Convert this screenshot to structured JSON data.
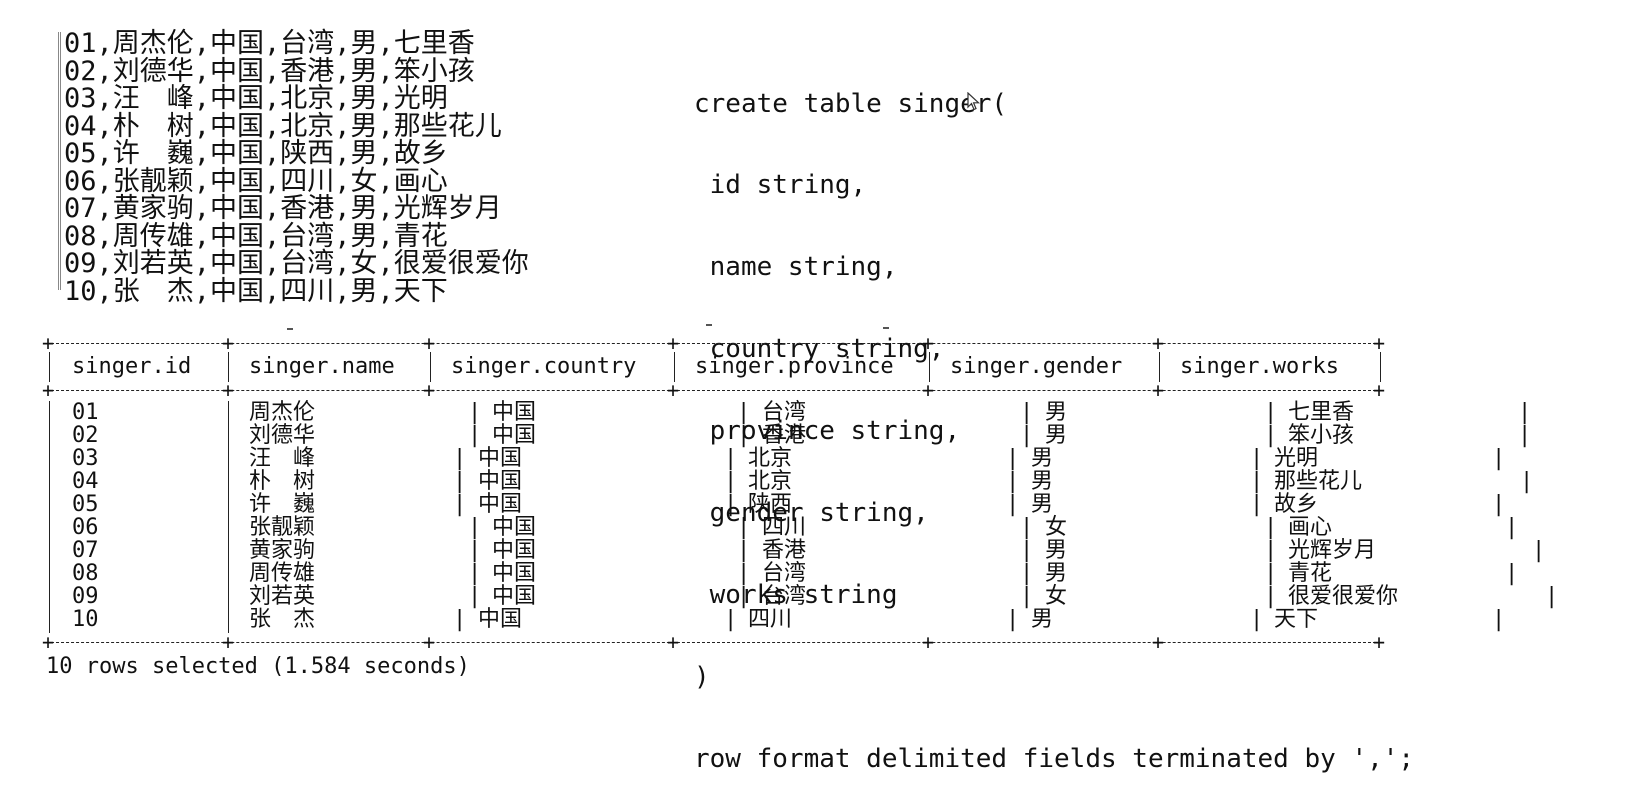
{
  "raw_lines": [
    "01,周杰伦,中国,台湾,男,七里香",
    "02,刘德华,中国,香港,男,笨小孩",
    "03,汪　峰,中国,北京,男,光明",
    "04,朴　树,中国,北京,男,那些花儿",
    "05,许　巍,中国,陕西,男,故乡",
    "06,张靓颖,中国,四川,女,画心",
    "07,黄家驹,中国,香港,男,光辉岁月",
    "08,周传雄,中国,台湾,男,青花",
    "09,刘若英,中国,台湾,女,很爱很爱你",
    "10,张　杰,中国,四川,男,天下"
  ],
  "ddl_lines": [
    "create table singer(",
    " id string,",
    " name string,",
    " country string,",
    " province string,",
    " gender string,",
    " works string",
    ")",
    "row format delimited fields terminated by ',';"
  ],
  "result": {
    "columns": [
      "singer.id",
      "singer.name",
      "singer.country",
      "singer.province",
      "singer.gender",
      "singer.works"
    ],
    "rows": [
      [
        "01",
        "周杰伦",
        "中国",
        "台湾",
        "男",
        "七里香"
      ],
      [
        "02",
        "刘德华",
        "中国",
        "香港",
        "男",
        "笨小孩"
      ],
      [
        "03",
        "汪　峰",
        "中国",
        "北京",
        "男",
        "光明"
      ],
      [
        "04",
        "朴　树",
        "中国",
        "北京",
        "男",
        "那些花儿"
      ],
      [
        "05",
        "许　巍",
        "中国",
        "陕西",
        "男",
        "故乡"
      ],
      [
        "06",
        "张靓颖",
        "中国",
        "四川",
        "女",
        "画心"
      ],
      [
        "07",
        "黄家驹",
        "中国",
        "香港",
        "男",
        "光辉岁月"
      ],
      [
        "08",
        "周传雄",
        "中国",
        "台湾",
        "男",
        "青花"
      ],
      [
        "09",
        "刘若英",
        "中国",
        "台湾",
        "女",
        "很爱很爱你"
      ],
      [
        "10",
        "张　杰",
        "中国",
        "四川",
        "男",
        "天下"
      ]
    ],
    "footer": "10 rows selected (1.584 seconds)"
  },
  "icons": {
    "cursor": "mouse-pointer-icon"
  }
}
